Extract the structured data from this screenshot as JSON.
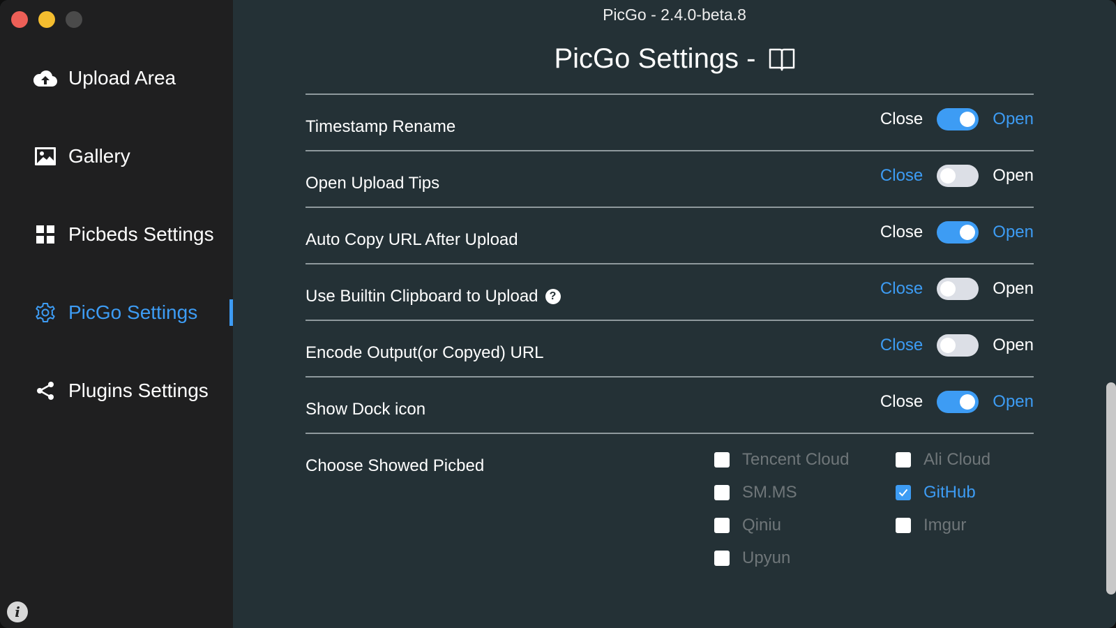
{
  "window": {
    "title": "PicGo - 2.4.0-beta.8",
    "traffic_colors": [
      "#ed5f57",
      "#f4bd2f",
      "#4a4a4a"
    ]
  },
  "sidebar": {
    "items": [
      {
        "label": "Upload Area",
        "icon": "cloud-upload-icon",
        "active": false
      },
      {
        "label": "Gallery",
        "icon": "image-icon",
        "active": false
      },
      {
        "label": "Picbeds Settings",
        "icon": "grid-icon",
        "active": false
      },
      {
        "label": "PicGo Settings",
        "icon": "gear-icon",
        "active": true
      },
      {
        "label": "Plugins Settings",
        "icon": "share-icon",
        "active": false
      }
    ],
    "info_icon": "info-icon"
  },
  "main": {
    "page_title": "PicGo Settings -",
    "title_icon": "book-icon",
    "settings": [
      {
        "label": "Timestamp Rename",
        "off_label": "Close",
        "on_label": "Open",
        "on": true
      },
      {
        "label": "Open Upload Tips",
        "off_label": "Close",
        "on_label": "Open",
        "on": false
      },
      {
        "label": "Auto Copy URL After Upload",
        "off_label": "Close",
        "on_label": "Open",
        "on": true
      },
      {
        "label": "Use Builtin Clipboard to Upload",
        "off_label": "Close",
        "on_label": "Open",
        "on": false,
        "help": "?"
      },
      {
        "label": "Encode Output(or Copyed) URL",
        "off_label": "Close",
        "on_label": "Open",
        "on": false
      },
      {
        "label": "Show Dock icon",
        "off_label": "Close",
        "on_label": "Open",
        "on": true
      }
    ],
    "picbed": {
      "label": "Choose Showed Picbed",
      "options": [
        {
          "label": "Tencent Cloud",
          "checked": false
        },
        {
          "label": "Ali Cloud",
          "checked": false
        },
        {
          "label": "SM.MS",
          "checked": false
        },
        {
          "label": "GitHub",
          "checked": true
        },
        {
          "label": "Qiniu",
          "checked": false
        },
        {
          "label": "Imgur",
          "checked": false
        },
        {
          "label": "Upyun",
          "checked": false
        }
      ]
    }
  },
  "colors": {
    "accent": "#3d9cf4",
    "sidebar_bg": "#1f1f20",
    "main_bg": "#243136"
  }
}
